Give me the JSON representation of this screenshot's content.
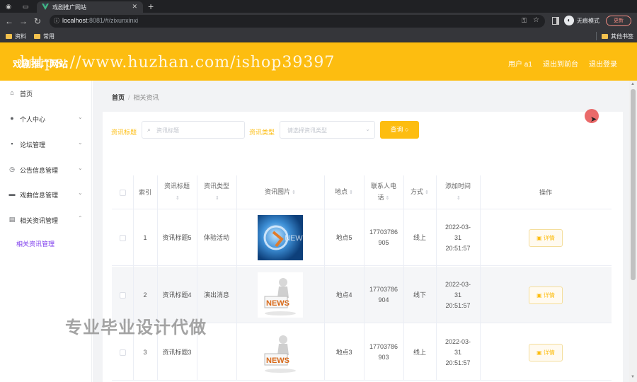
{
  "browser": {
    "tab_title": "戏剧推广网站",
    "url_host": "localhost",
    "url_rest": ":8081/#/zixunxinxi",
    "incognito_label": "无痕模式",
    "update_label": "更新",
    "bookmarks": [
      "资料",
      "常用"
    ],
    "other_bookmarks": "其他书签"
  },
  "header": {
    "title": "戏剧推广网站",
    "watermark": "https://www.huzhan.com/ishop39397",
    "user": "用户 a1",
    "exit_backend": "退出到前台",
    "logout": "退出登录"
  },
  "sidebar": {
    "items": [
      {
        "label": "首页",
        "icon": "home-icon",
        "arrow": ""
      },
      {
        "label": "个人中心",
        "icon": "user-icon",
        "arrow": "⌄"
      },
      {
        "label": "论坛管理",
        "icon": "chat-icon",
        "arrow": "⌄"
      },
      {
        "label": "公告信息管理",
        "icon": "compass-icon",
        "arrow": "⌄"
      },
      {
        "label": "戏曲信息管理",
        "icon": "monitor-icon",
        "arrow": "⌄"
      },
      {
        "label": "相关资讯管理",
        "icon": "document-icon",
        "arrow": "⌃"
      }
    ],
    "active_sub": "相关资讯管理"
  },
  "breadcrumb": {
    "home": "首页",
    "separator": "/",
    "current": "相关资讯"
  },
  "search": {
    "title_label": "资讯标题",
    "title_placeholder": "资讯标题",
    "type_label": "资讯类型",
    "type_placeholder": "请选择资讯类型",
    "query_label": "查询"
  },
  "table": {
    "headers": {
      "index": "索引",
      "title": "资讯标题",
      "type": "资讯类型",
      "image": "资讯图片",
      "place": "地点",
      "phone": "联系人电话",
      "mode": "方式",
      "time": "添加时间",
      "action": "操作"
    },
    "rows": [
      {
        "index": "1",
        "title": "资讯标题5",
        "type": "体验活动",
        "place": "地点5",
        "phone": "17703786905",
        "mode": "线上",
        "time": "2022-03-31 20:51:57",
        "image": "image-news-icon"
      },
      {
        "index": "2",
        "title": "资讯标题4",
        "type": "演出消息",
        "place": "地点4",
        "phone": "17703786904",
        "mode": "线下",
        "time": "2022-03-31 20:51:57",
        "image": "news-figure-icon"
      },
      {
        "index": "3",
        "title": "资讯标题3",
        "type": "",
        "place": "地点3",
        "phone": "17703786903",
        "mode": "线上",
        "time": "2022-03-31 20:51:57",
        "image": "news-figure-icon"
      }
    ],
    "detail_label": "详情"
  },
  "overlay_text": "专业毕业设计代做",
  "colors": {
    "accent": "#fdbd10",
    "submenu_active": "#7c3aed"
  }
}
